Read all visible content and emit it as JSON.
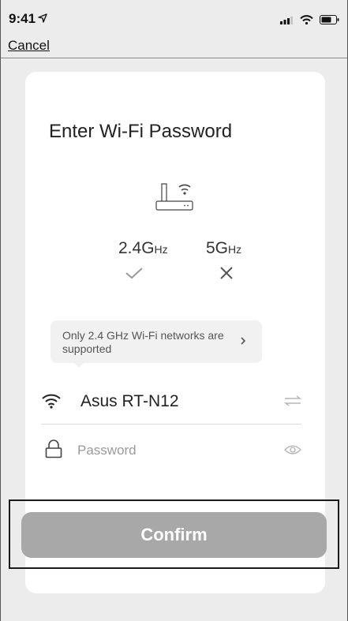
{
  "status_bar": {
    "time": "9:41",
    "location_icon": "location-arrow-icon",
    "signal_icon": "cellular-signal-icon",
    "wifi_icon": "wifi-icon",
    "battery_icon": "battery-icon"
  },
  "nav": {
    "cancel_label": "Cancel"
  },
  "card": {
    "title": "Enter Wi-Fi Password",
    "router_icon": "router-icon",
    "bands": [
      {
        "main": "2.4G",
        "unit": "Hz",
        "supported": true,
        "status_icon": "checkmark-icon"
      },
      {
        "main": "5G",
        "unit": "Hz",
        "supported": false,
        "status_icon": "x-icon"
      }
    ],
    "tip": {
      "text": "Only 2.4 GHz Wi-Fi networks are supported",
      "chevron_icon": "chevron-right-icon"
    },
    "network": {
      "ssid": "Asus RT-N12",
      "icon": "wifi-icon",
      "switch_icon": "switch-network-icon"
    },
    "password": {
      "placeholder": "Password",
      "value": "",
      "lock_icon": "lock-icon",
      "eye_icon": "eye-icon"
    },
    "confirm_label": "Confirm"
  },
  "colors": {
    "background": "#ececec",
    "card": "#ffffff",
    "button_disabled": "#a8a8a8",
    "tip_background": "#f1f1f1"
  }
}
